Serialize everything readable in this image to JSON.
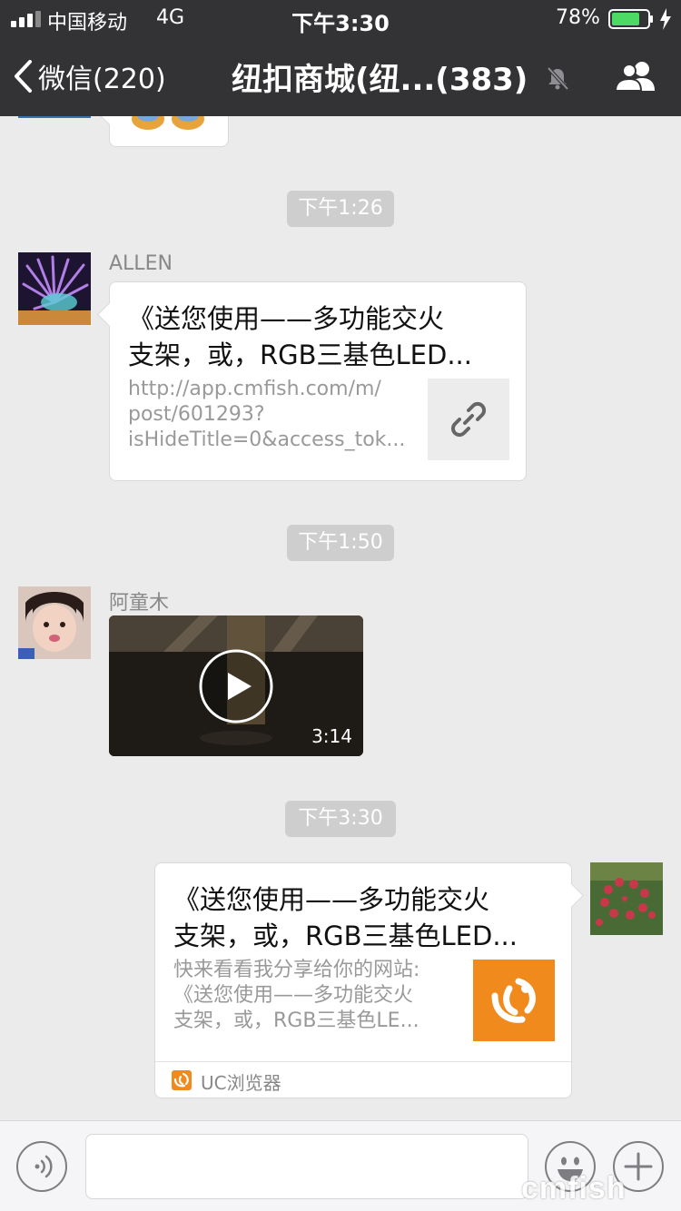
{
  "status_bar": {
    "carrier": "中国移动",
    "network": "4G",
    "time": "下午3:30",
    "battery": "78%",
    "battery_level": 0.78
  },
  "nav": {
    "back_label": "微信(220)",
    "title": "纽扣商城(纽...(383)"
  },
  "timestamps": [
    "下午1:26",
    "下午1:50",
    "下午3:30"
  ],
  "messages": {
    "allen": {
      "sender": "ALLEN",
      "title_line1": "《送您使用——多功能交火",
      "title_line2": "支架，或，RGB三基色LED...",
      "desc_line1": "http://app.cmfish.com/m/",
      "desc_line2": "post/601293?",
      "desc_line3": "isHideTitle=0&access_tok..."
    },
    "atongmu": {
      "sender": "阿童木",
      "video_duration": "3:14"
    },
    "self": {
      "title_line1": "《送您使用——多功能交火",
      "title_line2": "支架，或，RGB三基色LED...",
      "desc_line1": "快来看看我分享给你的网站:",
      "desc_line2": "《送您使用——多功能交火",
      "desc_line3": "支架，或，RGB三基色LE...",
      "source": "UC浏览器"
    }
  },
  "watermark": "cmfish",
  "colors": {
    "header_bg": "#333336",
    "chat_bg": "#ebebeb",
    "battery_green": "#4cd964",
    "uc_orange": "#f08a1d"
  }
}
